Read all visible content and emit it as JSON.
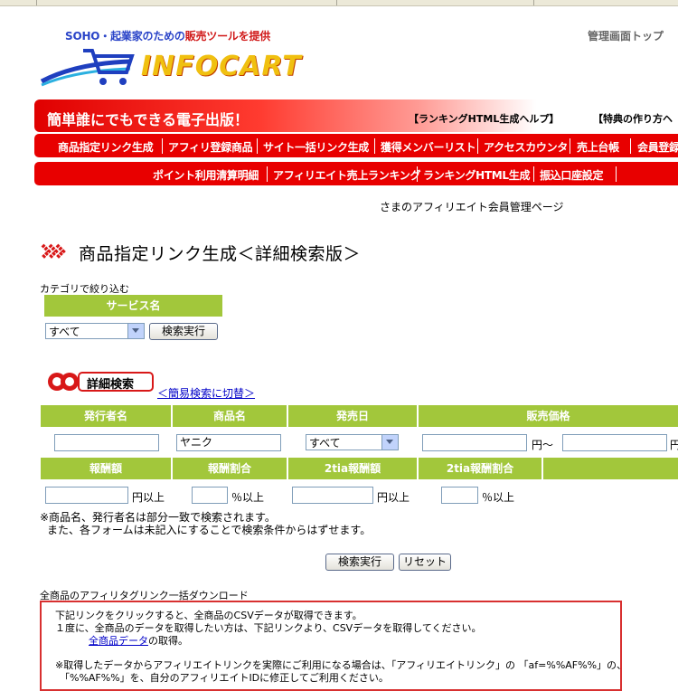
{
  "header": {
    "tagline_part1": "SOHO・起業家のための",
    "tagline_part2": "販売ツールを提供",
    "logo_text": "INFOCART",
    "admin_top_link": "管理画面トップ"
  },
  "banner": {
    "title": "簡単誰にでもできる電子出版！",
    "link1": "【ランキングHTML生成ヘルプ】",
    "link2": "【特典の作り方ヘ"
  },
  "nav1": [
    "商品指定リンク生成",
    "アフィリ登録商品",
    "サイト一括リンク生成",
    "獲得メンバーリスト",
    "アクセスカウンタ",
    "売上台帳",
    "会員登録"
  ],
  "nav2": [
    "ポイント利用清算明細",
    "アフィリエイト売上ランキング",
    "ランキングHTML生成",
    "振込口座設定"
  ],
  "member_note": "さまのアフィリエイト会員管理ページ",
  "page_title": "商品指定リンク生成＜詳細検索版＞",
  "category": {
    "label": "カテゴリで絞り込む",
    "service_header": "サービス名",
    "select_value": "すべて",
    "search_button": "検索実行"
  },
  "detail": {
    "badge": "詳細検索",
    "switch_link": "＜簡易検索に切替＞"
  },
  "form": {
    "headers_row1": [
      "発行者名",
      "商品名",
      "発売日",
      "販売価格"
    ],
    "product_name_value": "ヤニク",
    "release_select": "すべて",
    "yen_tilde": "円～",
    "yen_tail": "円",
    "headers_row2": [
      "報酬額",
      "報酬割合",
      "2tia報酬額",
      "2tia報酬割合"
    ],
    "yen_over": "円以上",
    "pct_over": "％以上",
    "yen_over2": "円以上",
    "pct_over2": "％以上"
  },
  "notes": {
    "line1": "※商品名、発行者名は部分一致で検索されます。",
    "line2": "また、各フォームは未記入にすることで検索条件からはずせます。"
  },
  "actions": {
    "search": "検索実行",
    "reset": "リセット"
  },
  "download": {
    "title": "全商品のアフィリタグリンク一括ダウンロード",
    "line1": "下記リンクをクリックすると、全商品のCSVデータが取得できます。",
    "line2": "１度に、全商品のデータを取得したい方は、下記リンクより、CSVデータを取得してください。",
    "link_text": "全商品データ",
    "link_suffix": "の取得。",
    "line4": "※取得したデータからアフィリエイトリンクを実際にご利用になる場合は、「アフィリエイトリンク」の 「af=%%AF%%」の、",
    "line5": "「%%AF%%」を、自分のアフィリエイトIDに修正してご利用ください。"
  },
  "colors": {
    "brand_red": "#e80000",
    "header_green": "#a2c73b",
    "link_blue": "#0000c8"
  }
}
